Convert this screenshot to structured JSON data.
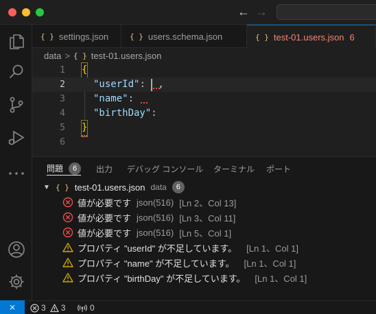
{
  "tabs": [
    {
      "label": "settings.json",
      "icon": "json-braces-icon"
    },
    {
      "label": "users.schema.json",
      "icon": "json-braces-icon"
    },
    {
      "label": "test-01.users.json",
      "icon": "json-braces-icon",
      "problem_count": "6",
      "active": true
    }
  ],
  "breadcrumb": {
    "folder": "data",
    "file": "test-01.users.json",
    "separator": ">"
  },
  "editor": {
    "lines": [
      {
        "number": "1",
        "text": "{"
      },
      {
        "number": "2",
        "key": "\"userId\"",
        "colon": ":",
        "tail": ","
      },
      {
        "number": "3",
        "key": "\"name\"",
        "colon": ":"
      },
      {
        "number": "4",
        "key": "\"birthDay\"",
        "colon": ":"
      },
      {
        "number": "5",
        "text": "}"
      },
      {
        "number": "6",
        "text": ""
      }
    ]
  },
  "panel": {
    "tabs": [
      {
        "label": "問題",
        "badge": "6",
        "active": true
      },
      {
        "label": "出力"
      },
      {
        "label": "デバッグ コンソール"
      },
      {
        "label": "ターミナル"
      },
      {
        "label": "ポート"
      }
    ],
    "file": {
      "name": "test-01.users.json",
      "path": "data",
      "count": "6"
    },
    "problems": [
      {
        "severity": "error",
        "message": "値が必要です",
        "source": "json(516)",
        "location": "[Ln 2、Col 13]"
      },
      {
        "severity": "error",
        "message": "値が必要です",
        "source": "json(516)",
        "location": "[Ln 3、Col 11]"
      },
      {
        "severity": "error",
        "message": "値が必要です",
        "source": "json(516)",
        "location": "[Ln 5、Col 1]"
      },
      {
        "severity": "warning",
        "message": "プロパティ \"userId\" が不足しています。",
        "location": "[Ln 1、Col 1]"
      },
      {
        "severity": "warning",
        "message": "プロパティ \"name\" が不足しています。",
        "location": "[Ln 1、Col 1]"
      },
      {
        "severity": "warning",
        "message": "プロパティ \"birthDay\" が不足しています。",
        "location": "[Ln 1、Col 1]"
      }
    ]
  },
  "statusbar": {
    "errors": "3",
    "warnings": "3",
    "ports": "0"
  },
  "colors": {
    "accent": "#0078d4",
    "error": "#f14c4c",
    "warning": "#cca700",
    "tab_error_text": "#f48771"
  }
}
